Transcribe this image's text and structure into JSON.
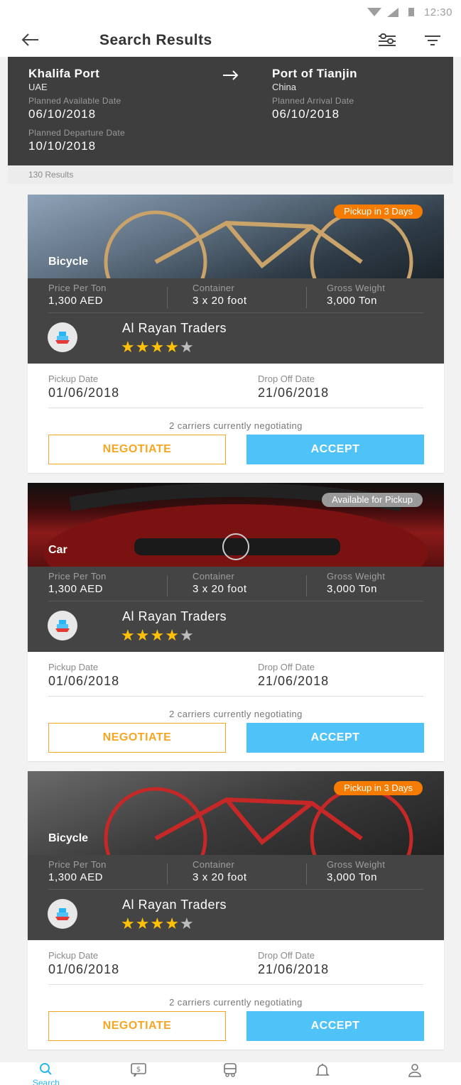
{
  "status_bar": {
    "time": "12:30"
  },
  "header": {
    "title": "Search Results"
  },
  "route": {
    "origin": {
      "port": "Khalifa Port",
      "country": "UAE",
      "date_label": "Planned Available Date",
      "date": "06/10/2018"
    },
    "destination": {
      "port": "Port of Tianjin",
      "country": "China",
      "date_label": "Planned Arrival Date",
      "date": "06/10/2018"
    },
    "departure": {
      "label": "Planned Departure Date",
      "date": "10/10/2018"
    }
  },
  "results": {
    "count_text": "130 Results"
  },
  "cards": [
    {
      "cargo": "Bicycle",
      "pill": "Pickup in 3 Days",
      "pill_color": "#f57c00",
      "stats": [
        {
          "label": "Price Per Ton",
          "value": "1,300 AED"
        },
        {
          "label": "Container",
          "value": "3 x 20 foot"
        },
        {
          "label": "Gross Weight",
          "value": "3,000 Ton"
        }
      ],
      "trader": "Al Rayan Traders",
      "rating": 4,
      "rating_max": 5,
      "pickup_label": "Pickup Date",
      "pickup_date": "01/06/2018",
      "dropoff_label": "Drop Off Date",
      "dropoff_date": "21/06/2018",
      "negotiating_text": "2 carriers currently negotiating",
      "negotiate_label": "NEGOTIATE",
      "accept_label": "ACCEPT"
    },
    {
      "cargo": "Car",
      "pill": "Available for Pickup",
      "pill_color": "#9a9a9a",
      "stats": [
        {
          "label": "Price Per Ton",
          "value": "1,300 AED"
        },
        {
          "label": "Container",
          "value": "3 x 20 foot"
        },
        {
          "label": "Gross Weight",
          "value": "3,000 Ton"
        }
      ],
      "trader": "Al Rayan Traders",
      "rating": 4,
      "rating_max": 5,
      "pickup_label": "Pickup Date",
      "pickup_date": "01/06/2018",
      "dropoff_label": "Drop Off Date",
      "dropoff_date": "21/06/2018",
      "negotiating_text": "2 carriers currently negotiating",
      "negotiate_label": "NEGOTIATE",
      "accept_label": "ACCEPT"
    },
    {
      "cargo": "Bicycle",
      "pill": "Pickup in 3 Days",
      "pill_color": "#f57c00",
      "stats": [
        {
          "label": "Price Per Ton",
          "value": "1,300 AED"
        },
        {
          "label": "Container",
          "value": "3 x 20 foot"
        },
        {
          "label": "Gross Weight",
          "value": "3,000 Ton"
        }
      ],
      "trader": "Al Rayan Traders",
      "rating": 4,
      "rating_max": 5,
      "pickup_label": "Pickup Date",
      "pickup_date": "01/06/2018",
      "dropoff_label": "Drop Off Date",
      "dropoff_date": "21/06/2018",
      "negotiating_text": "2 carriers currently negotiating",
      "negotiate_label": "NEGOTIATE",
      "accept_label": "ACCEPT"
    }
  ],
  "bottom_nav": [
    {
      "label": "Search",
      "icon": "search-icon",
      "active": true
    },
    {
      "label": "",
      "icon": "payment-chat-icon",
      "active": false
    },
    {
      "label": "",
      "icon": "truck-icon",
      "active": false
    },
    {
      "label": "",
      "icon": "bell-icon",
      "active": false
    },
    {
      "label": "",
      "icon": "profile-icon",
      "active": false
    }
  ],
  "colors": {
    "accent": "#4fc3f7",
    "warning": "#f5a623",
    "panel": "#444444",
    "star": "#ffc107"
  }
}
